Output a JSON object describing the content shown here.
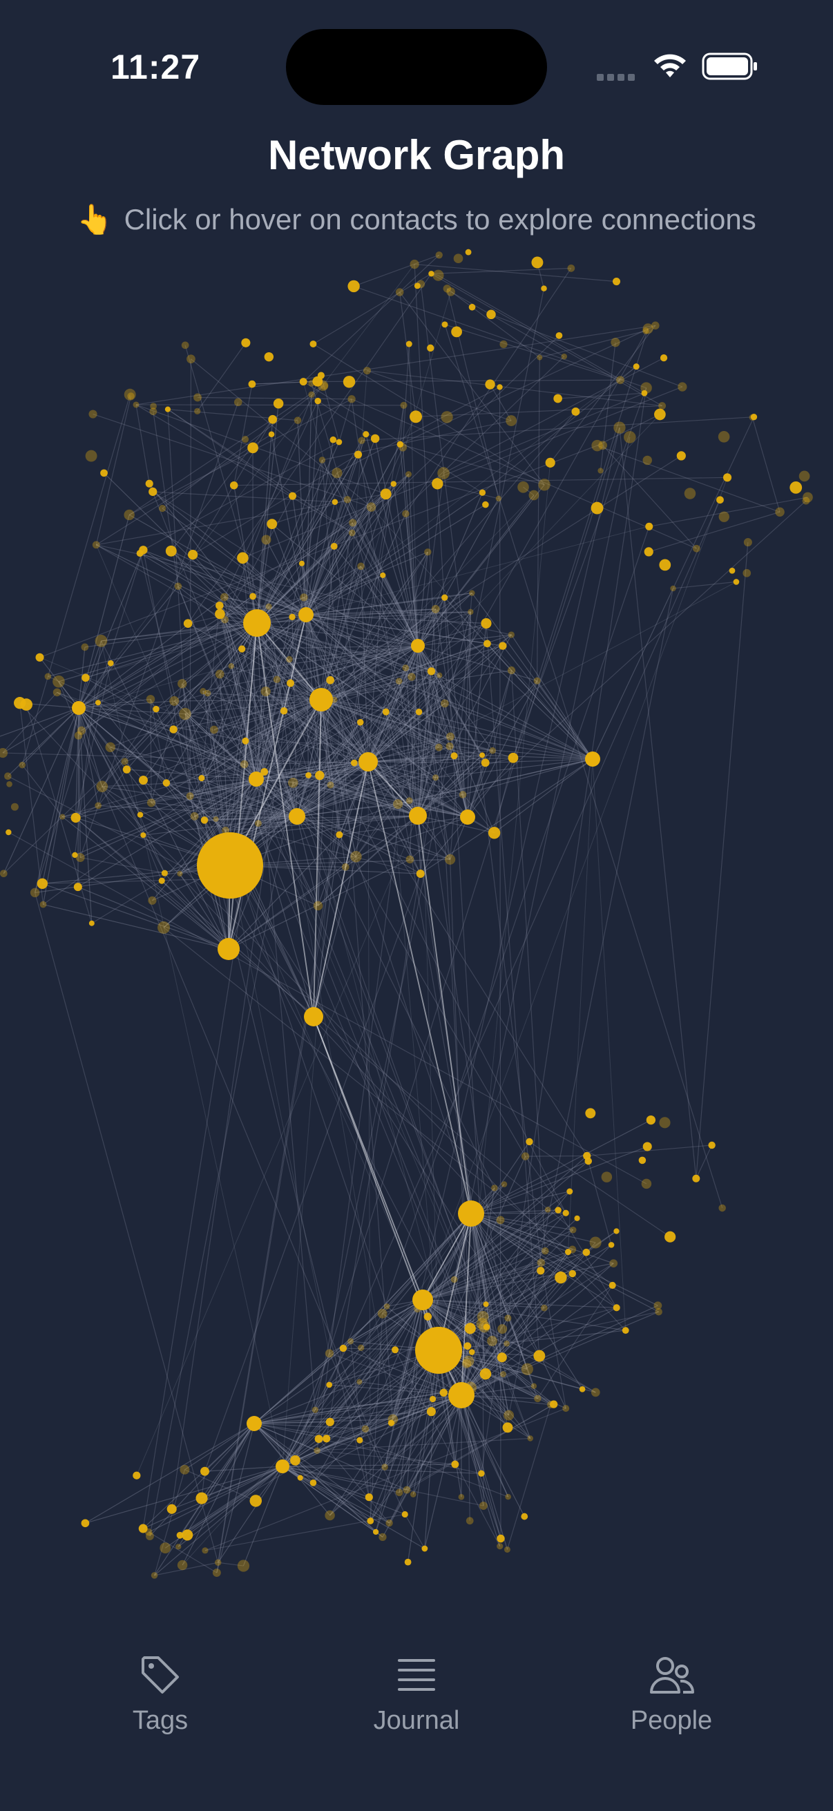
{
  "status_bar": {
    "time": "11:27"
  },
  "header": {
    "title": "Network Graph",
    "subtitle_icon": "pointing-hand-emoji",
    "subtitle_emoji": "👆",
    "subtitle": "Click or hover on contacts to explore connections"
  },
  "graph": {
    "node_color": "#e8b00c",
    "edge_color": "#8e95a8",
    "highlight_edge_color": "#e6e8ee",
    "background": "#1e2639"
  },
  "tabs": [
    {
      "label": "Tags",
      "icon": "tag-icon"
    },
    {
      "label": "Journal",
      "icon": "journal-icon"
    },
    {
      "label": "People",
      "icon": "people-icon"
    }
  ]
}
